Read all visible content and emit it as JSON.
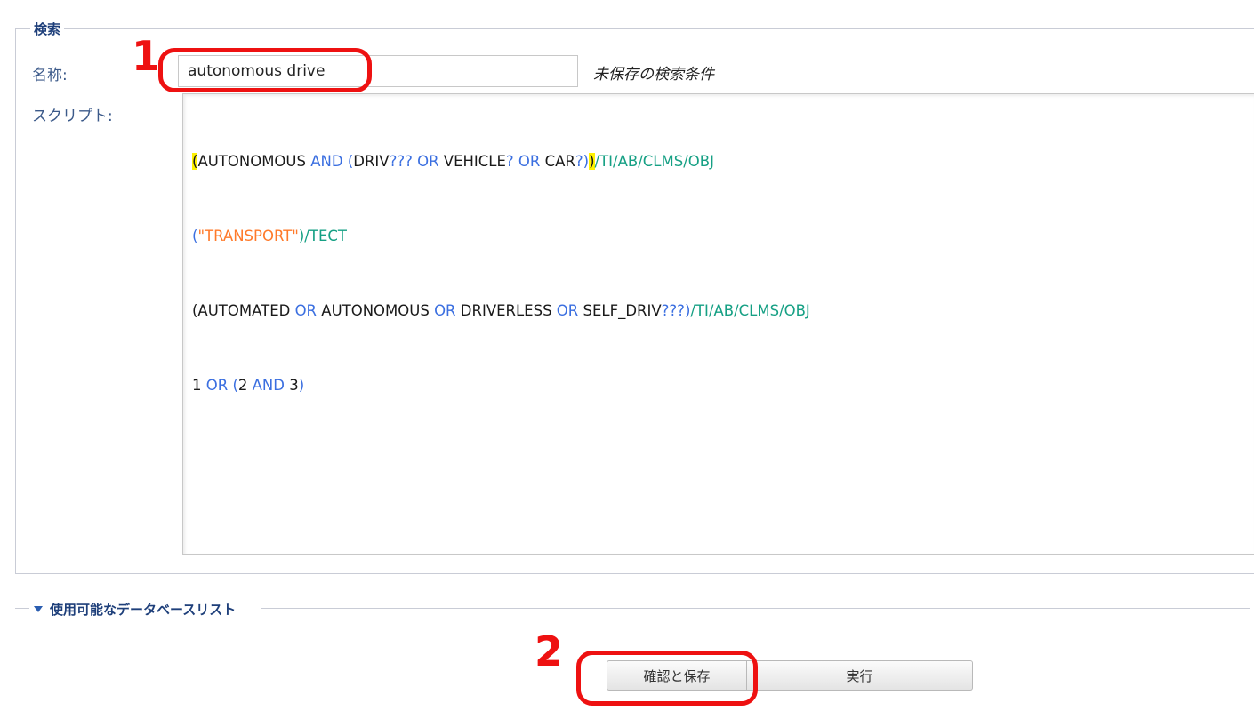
{
  "search": {
    "legend": "検索",
    "name_label": "名称:",
    "name_value": "autonomous drive",
    "unsaved_note": "未保存の検索条件",
    "script_label": "スクリプト:",
    "script": {
      "line1": {
        "hl_open": "(",
        "w1": "AUTONOMOUS",
        "op_and": " AND ",
        "p_open": "(",
        "w2": "DRIV",
        "q1": "??? OR ",
        "w3": "VEHICLE",
        "q2": "? OR ",
        "w4": "CAR",
        "q3": "?)",
        "hl_close": ")",
        "field": "/TI/AB/CLMS/OBJ"
      },
      "line2": {
        "open": "(",
        "str": "\"TRANSPORT\"",
        "field": ")/TECT"
      },
      "line3": {
        "w1": "(AUTOMATED",
        "op1": " OR ",
        "w2": "AUTONOMOUS",
        "op2": " OR ",
        "w3": "DRIVERLESS",
        "op3": " OR ",
        "w4": "SELF_DRIV",
        "q": "???)",
        "field": "/TI/AB/CLMS/OBJ"
      },
      "line4": {
        "n1": "1",
        "op_or": " OR ",
        "p_open": "(",
        "n2": "2",
        "op_and": " AND ",
        "n3": "3",
        "p_close": ")"
      }
    }
  },
  "databases": {
    "toggle_label": "使用可能なデータベースリスト",
    "toggle_icon": "caret-down-icon"
  },
  "actions": {
    "save_label": "確認と保存",
    "run_label": "実行"
  },
  "annotations": {
    "step1": "1",
    "step2": "2",
    "color": "#ee1111"
  },
  "colors": {
    "operator": "#3b6fe0",
    "field": "#16a084",
    "string": "#ff7a2a",
    "highlight": "#fff200",
    "label": "#3c5a8a"
  }
}
